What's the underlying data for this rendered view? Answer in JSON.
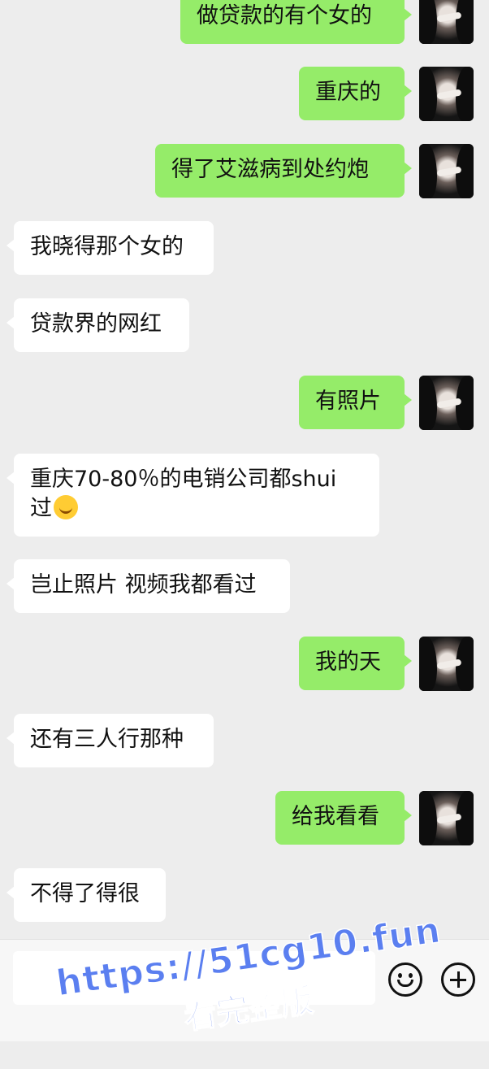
{
  "messages": [
    {
      "side": "right",
      "text": "做贷款的有个女的"
    },
    {
      "side": "right",
      "text": "重庆的"
    },
    {
      "side": "right",
      "text": "得了艾滋病到处约炮"
    },
    {
      "side": "left",
      "text": "我晓得那个女的"
    },
    {
      "side": "left",
      "text": "贷款界的网红"
    },
    {
      "side": "right",
      "text": "有照片"
    },
    {
      "side": "left",
      "text_line1": "重庆70-80％的电销公司都shui",
      "text_line2": "过",
      "emoji": "crying-laughing-emoji"
    },
    {
      "side": "left",
      "text": "岂止照片 视频我都看过"
    },
    {
      "side": "right",
      "text": "我的天"
    },
    {
      "side": "left",
      "text": "还有三人行那种"
    },
    {
      "side": "right",
      "text": "给我看看"
    },
    {
      "side": "left",
      "text": "不得了得很"
    }
  ],
  "input_bar": {
    "value": "",
    "emoji_button_icon": "smiley-icon",
    "more_button_icon": "plus-icon"
  },
  "watermark": {
    "url": "https://51cg10.fun",
    "cta": "看完整版"
  },
  "colors": {
    "sent_bubble": "#95ec69",
    "received_bubble": "#ffffff",
    "background": "#ededed",
    "watermark": "#5b7ff0"
  }
}
